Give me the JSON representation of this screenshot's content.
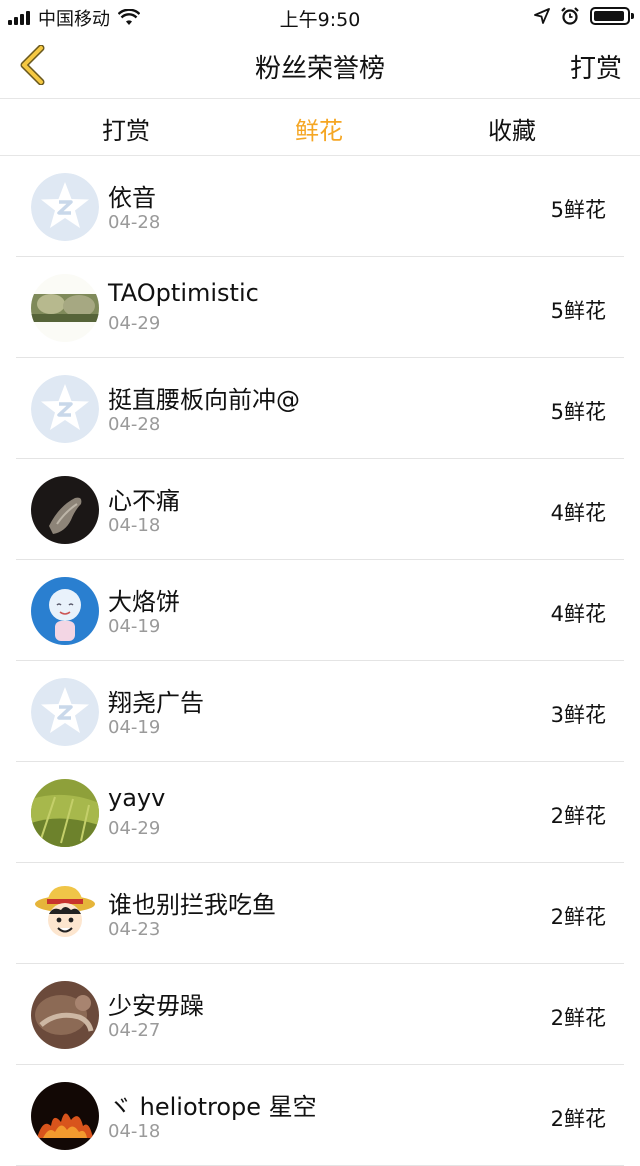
{
  "status_bar": {
    "carrier": "中国移动",
    "time": "上午9:50"
  },
  "nav": {
    "title": "粉丝荣誉榜",
    "right_label": "打赏",
    "accent_color": "#f5a623"
  },
  "tabs": [
    {
      "label": "打赏",
      "active": false
    },
    {
      "label": "鲜花",
      "active": true
    },
    {
      "label": "收藏",
      "active": false
    }
  ],
  "fans": [
    {
      "name": "依音",
      "date": "04-28",
      "count": "5鲜花",
      "avatar": "default-star-avatar-icon"
    },
    {
      "name": "TAOptimistic",
      "date": "04-29",
      "count": "5鲜花",
      "avatar": "landscape-avatar"
    },
    {
      "name": "挺直腰板向前冲@",
      "date": "04-28",
      "count": "5鲜花",
      "avatar": "default-star-avatar-icon"
    },
    {
      "name": "心不痛",
      "date": "04-18",
      "count": "4鲜花",
      "avatar": "dark-hand-avatar"
    },
    {
      "name": "大烙饼",
      "date": "04-19",
      "count": "4鲜花",
      "avatar": "blue-cartoon-avatar"
    },
    {
      "name": "翔尧广告",
      "date": "04-19",
      "count": "3鲜花",
      "avatar": "default-star-avatar-icon"
    },
    {
      "name": "yayv",
      "date": "04-29",
      "count": "2鲜花",
      "avatar": "green-field-avatar"
    },
    {
      "name": "谁也别拦我吃鱼",
      "date": "04-23",
      "count": "2鲜花",
      "avatar": "straw-hat-cartoon-avatar"
    },
    {
      "name": "少安毋躁",
      "date": "04-27",
      "count": "2鲜花",
      "avatar": "brown-photo-avatar"
    },
    {
      "name": "ヾ heliotrope 星空",
      "date": "04-18",
      "count": "2鲜花",
      "avatar": "fire-text-avatar"
    }
  ]
}
